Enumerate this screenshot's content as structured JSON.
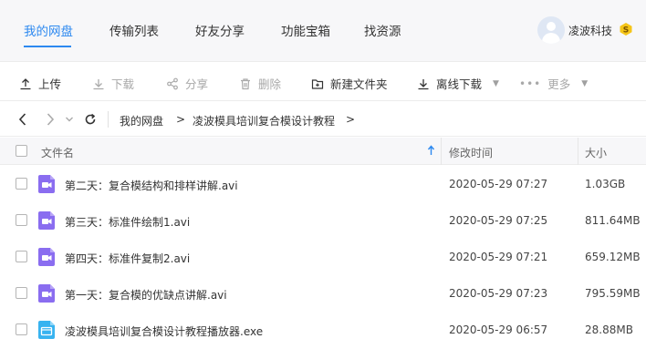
{
  "nav": {
    "tabs": [
      {
        "label": "我的网盘",
        "active": true
      },
      {
        "label": "传输列表",
        "active": false
      },
      {
        "label": "好友分享",
        "active": false
      },
      {
        "label": "功能宝箱",
        "active": false
      },
      {
        "label": "找资源",
        "active": false
      }
    ],
    "username": "凌波科技",
    "vip_badge": "S"
  },
  "toolbar": {
    "upload": "上传",
    "download": "下载",
    "share": "分享",
    "delete": "删除",
    "new_folder": "新建文件夹",
    "offline_download": "离线下载",
    "more": "更多"
  },
  "breadcrumb": {
    "items": [
      "我的网盘",
      "凌波模具培训复合模设计教程"
    ],
    "separator": ">"
  },
  "table": {
    "headers": {
      "name": "文件名",
      "modified": "修改时间",
      "size": "大小"
    },
    "rows": [
      {
        "name": "第二天：复合模结构和排样讲解.avi",
        "modified": "2020-05-29 07:27",
        "size": "1.03GB",
        "type": "video"
      },
      {
        "name": "第三天：标准件绘制1.avi",
        "modified": "2020-05-29 07:25",
        "size": "811.64MB",
        "type": "video"
      },
      {
        "name": "第四天：标准件复制2.avi",
        "modified": "2020-05-29 07:21",
        "size": "659.12MB",
        "type": "video"
      },
      {
        "name": "第一天：复合模的优缺点讲解.avi",
        "modified": "2020-05-29 07:23",
        "size": "795.59MB",
        "type": "video"
      },
      {
        "name": "凌波模具培训复合模设计教程播放器.exe",
        "modified": "2020-05-29 06:57",
        "size": "28.88MB",
        "type": "exe"
      }
    ]
  },
  "colors": {
    "accent": "#2d89f0",
    "video_icon": "#8a6df0",
    "exe_icon": "#38b3f0",
    "vip_badge": "#f5c518"
  }
}
